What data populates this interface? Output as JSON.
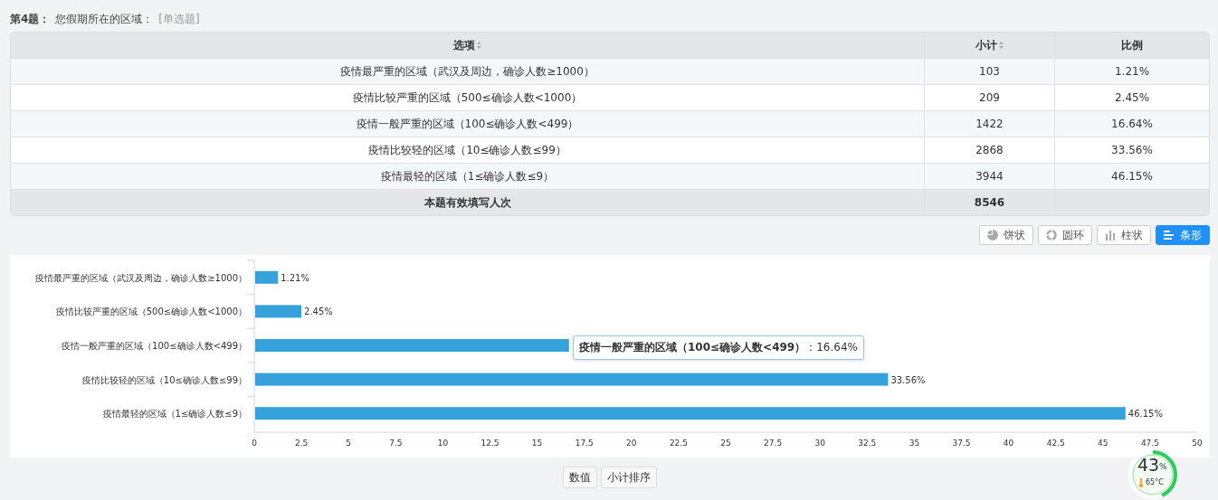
{
  "question": {
    "number": "第4题：",
    "title": "您假期所在的区域：",
    "type": "[单选题]"
  },
  "table": {
    "columns": [
      {
        "label": "选项",
        "sortable": true
      },
      {
        "label": "小计",
        "sortable": true
      },
      {
        "label": "比例",
        "sortable": false
      }
    ],
    "rows": [
      {
        "option": "疫情最严重的区域（武汉及周边，确诊人数≥1000）",
        "count": "103",
        "percent": "1.21%"
      },
      {
        "option": "疫情比较严重的区域（500≤确诊人数<1000）",
        "count": "209",
        "percent": "2.45%"
      },
      {
        "option": "疫情一般严重的区域（100≤确诊人数<499）",
        "count": "1422",
        "percent": "16.64%"
      },
      {
        "option": "疫情比较轻的区域（10≤确诊人数≤99）",
        "count": "2868",
        "percent": "33.56%"
      },
      {
        "option": "疫情最轻的区域（1≤确诊人数≤9）",
        "count": "3944",
        "percent": "46.15%"
      }
    ],
    "total": {
      "label": "本题有效填写人次",
      "count": "8546"
    }
  },
  "chart_types": [
    {
      "kind": "pie",
      "label": "饼状",
      "selected": false
    },
    {
      "kind": "donut",
      "label": "圆环",
      "selected": false
    },
    {
      "kind": "column",
      "label": "柱状",
      "selected": false
    },
    {
      "kind": "bar",
      "label": "条形",
      "selected": true
    }
  ],
  "chart": {
    "chart_data": {
      "type": "bar",
      "orientation": "horizontal",
      "categories": [
        "疫情最严重的区域（武汉及周边，确诊人数≥1000）",
        "疫情比较严重的区域（500≤确诊人数<1000）",
        "疫情一般严重的区域（100≤确诊人数<499）",
        "疫情比较轻的区域（10≤确诊人数≤99）",
        "疫情最轻的区域（1≤确诊人数≤9）"
      ],
      "series": [
        {
          "color": "#35a2dc",
          "values": [
            1.21,
            2.45,
            16.64,
            33.56,
            46.15
          ]
        }
      ],
      "xlim": [
        0,
        50
      ],
      "xticks": [
        0,
        2.5,
        5,
        7.5,
        10,
        12.5,
        15,
        17.5,
        20,
        22.5,
        25,
        27.5,
        30,
        32.5,
        35,
        37.5,
        40,
        42.5,
        45,
        47.5,
        50
      ],
      "value_labels": [
        "1.21%",
        "2.45%",
        null,
        "33.56%",
        "46.15%"
      ]
    },
    "tooltip": {
      "text": "**疫情一般严重的区域（100≤确诊人数<499）**：16.64%"
    }
  },
  "bottom_buttons": [
    "数值",
    "小计排序"
  ],
  "monitor": {
    "level": 0.43,
    "reading": "43",
    "unit": "%",
    "temperature": "65°C"
  }
}
